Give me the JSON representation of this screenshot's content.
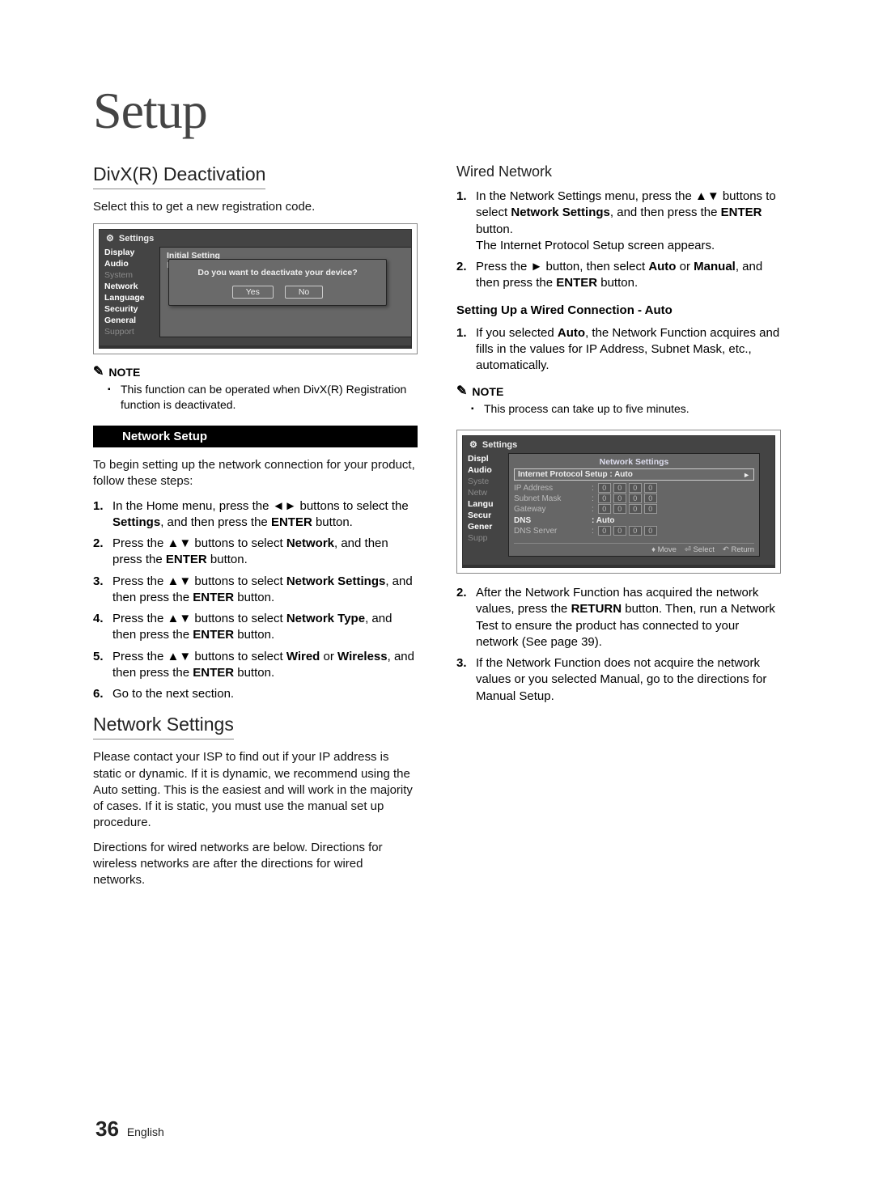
{
  "title": "Setup",
  "left": {
    "h2_divx": "DivX(R) Deactivation",
    "divx_p": "Select this to get a new registration code.",
    "osd1": {
      "title": "Settings",
      "menu": [
        "Display",
        "Audio",
        "System",
        "Network",
        "Language",
        "Security",
        "General",
        "Support"
      ],
      "content_line1": "Initial Setting",
      "content_line2": "Disc Menu",
      "dialog_q": "Do you want to deactivate your device?",
      "yes": "Yes",
      "no": "No"
    },
    "note_label": "NOTE",
    "note_item": "This function can be operated when DivX(R) Registration function is deactivated.",
    "sectionbar": "Network Setup",
    "ns_intro": "To begin setting up the network connection for your product, follow these steps:",
    "steps": [
      {
        "n": "1.",
        "pre": "In the Home menu, press the ",
        "sym": "◄►",
        "mid": " buttons to select the ",
        "b": "Settings",
        "post": ", and then press the ",
        "b2": "ENTER",
        "tail": " button."
      },
      {
        "n": "2.",
        "pre": "Press the ",
        "sym": "▲▼",
        "mid": " buttons to select ",
        "b": "Network",
        "post": ", and then press the ",
        "b2": "ENTER",
        "tail": " button."
      },
      {
        "n": "3.",
        "pre": "Press the ",
        "sym": "▲▼",
        "mid": " buttons to select ",
        "b": "Network Settings",
        "post": ", and then press the ",
        "b2": "ENTER",
        "tail": " button."
      },
      {
        "n": "4.",
        "pre": "Press the ",
        "sym": "▲▼",
        "mid": " buttons to select ",
        "b": "Network Type",
        "post": ", and then press the ",
        "b2": "ENTER",
        "tail": " button."
      },
      {
        "n": "5.",
        "pre": "Press the ",
        "sym": "▲▼",
        "mid": " buttons to select ",
        "b": "Wired",
        "post": " or ",
        "b2": "Wireless",
        "tail2": ", and then press the ",
        "b3": "ENTER",
        "tail3": " button."
      },
      {
        "n": "6.",
        "plain": "Go to the next section."
      }
    ],
    "h2_ns": "Network Settings",
    "ns_p1": "Please contact your ISP to find out if your IP address is static or dynamic. If it is dynamic, we recommend using the Auto setting. This is the easiest and will work in the majority of cases. If it is static, you must use the manual set up procedure.",
    "ns_p2": "Directions for wired networks are below. Directions for wireless networks are after the directions for wired networks."
  },
  "right": {
    "h3_wired": "Wired Network",
    "r_steps_a": [
      {
        "n": "1.",
        "parts": [
          {
            "t": "In the Network Settings menu, press the "
          },
          {
            "s": "▲▼"
          },
          {
            "t": " buttons to select "
          },
          {
            "b": "Network Settings"
          },
          {
            "t": ", and then press the "
          },
          {
            "b": "ENTER"
          },
          {
            "t": " button."
          },
          {
            "br": true
          },
          {
            "t": "The Internet Protocol Setup screen appears."
          }
        ]
      },
      {
        "n": "2.",
        "parts": [
          {
            "t": "Press the "
          },
          {
            "s": "►"
          },
          {
            "t": " button, then select "
          },
          {
            "b": "Auto"
          },
          {
            "t": " or "
          },
          {
            "b": "Manual"
          },
          {
            "t": ", and then press the "
          },
          {
            "b": "ENTER"
          },
          {
            "t": " button."
          }
        ]
      }
    ],
    "h4_auto": "Setting Up a Wired Connection - Auto",
    "auto_step": {
      "n": "1.",
      "parts": [
        {
          "t": "If you selected "
        },
        {
          "b": "Auto"
        },
        {
          "t": ", the Network Function acquires and fills in the values for IP Address, Subnet Mask, etc., automatically."
        }
      ]
    },
    "note2_item": "This process can take up to five minutes.",
    "osd2": {
      "title": "Settings",
      "menu": [
        "Display",
        "Audio",
        "System",
        "Network",
        "Language",
        "Security",
        "General",
        "Support"
      ],
      "panel_title": "Network Settings",
      "ips": "Internet Protocol Setup  : Auto",
      "rows": [
        {
          "label": "IP Address",
          "boxes": [
            "0",
            "0",
            "0",
            "0"
          ]
        },
        {
          "label": "Subnet Mask",
          "boxes": [
            "0",
            "0",
            "0",
            "0"
          ]
        },
        {
          "label": "Gateway",
          "boxes": [
            "0",
            "0",
            "0",
            "0"
          ]
        }
      ],
      "dns_label": "DNS",
      "dns_val": ": Auto",
      "dns_server_label": "DNS Server",
      "dns_server_boxes": [
        "0",
        "0",
        "0",
        "0"
      ],
      "foot_move": "Move",
      "foot_select": "Select",
      "foot_return": "Return"
    },
    "r_steps_b": [
      {
        "n": "2.",
        "parts": [
          {
            "t": "After the Network Function has acquired the network values, press the "
          },
          {
            "b": "RETURN"
          },
          {
            "t": " button. Then, run a Network Test to ensure the product has connected to your network (See page 39)."
          }
        ]
      },
      {
        "n": "3.",
        "parts": [
          {
            "t": "If the Network Function does not acquire the network values or you selected Manual, go to the directions for Manual Setup."
          }
        ]
      }
    ]
  },
  "footer": {
    "page": "36",
    "lang": "English"
  }
}
